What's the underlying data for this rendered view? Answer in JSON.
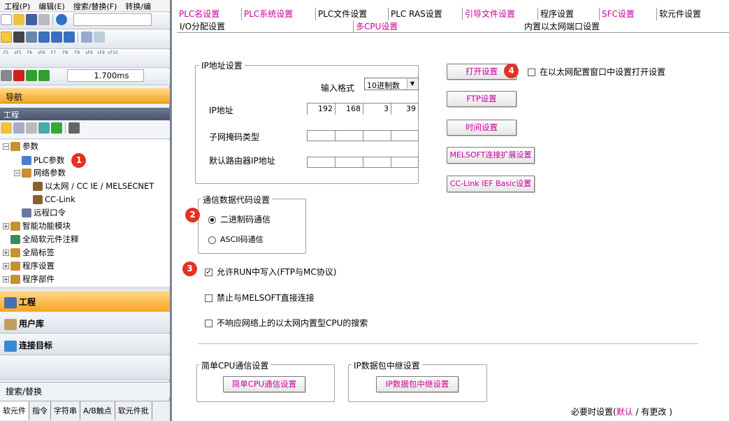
{
  "menu": [
    "工程(P)",
    "编辑(E)",
    "搜索/替换(F)",
    "转换/编"
  ],
  "toolbar": {
    "func_keys": [
      "F5",
      "sF5",
      "F6",
      "sF6",
      "F7",
      "F8",
      "F9",
      "sF9",
      "cF9",
      "cF10"
    ],
    "scan_time": "1.700ms"
  },
  "nav": {
    "header": "导航",
    "group_header": "工程",
    "tree": [
      {
        "label": "参数",
        "indent": 0,
        "expander": "−"
      },
      {
        "label": "PLC参数",
        "indent": 1,
        "badge": "1"
      },
      {
        "label": "网络参数",
        "indent": 1,
        "expander": "−"
      },
      {
        "label": "以太网 / CC IE / MELSECNET",
        "indent": 2
      },
      {
        "label": "CC-Link",
        "indent": 2
      },
      {
        "label": "远程口令",
        "indent": 1
      },
      {
        "label": "智能功能模块",
        "indent": 0,
        "expander": "+"
      },
      {
        "label": "全局软元件注释",
        "indent": 0
      },
      {
        "label": "全局标签",
        "indent": 0,
        "expander": "+"
      },
      {
        "label": "程序设置",
        "indent": 0,
        "expander": "+"
      },
      {
        "label": "程序部件",
        "indent": 0,
        "expander": "+"
      }
    ],
    "sections": [
      "工程",
      "用户库",
      "连接目标"
    ],
    "search_header": "搜索/替换",
    "bottom_tabs": [
      "软元件",
      "指令",
      "字符串",
      "A/B触点",
      "软元件批"
    ]
  },
  "dialog": {
    "tabs_row1": [
      {
        "label": "PLC名设置",
        "pink": true
      },
      {
        "label": "PLC系统设置",
        "pink": true
      },
      {
        "label": "PLC文件设置",
        "pink": false
      },
      {
        "label": "PLC RAS设置",
        "pink": false
      },
      {
        "label": "引导文件设置",
        "pink": true
      },
      {
        "label": "程序设置",
        "pink": false
      },
      {
        "label": "SFC设置",
        "pink": true
      },
      {
        "label": "软元件设置",
        "pink": false
      }
    ],
    "tabs_row2": [
      {
        "label": "I/O分配设置",
        "pink": false
      },
      {
        "label": "多CPU设置",
        "pink": true
      },
      {
        "label": "内置以太网端口设置",
        "pink": false
      }
    ],
    "ip_group": {
      "title": "IP地址设置",
      "input_format_label": "输入格式",
      "input_format_value": "10进制数",
      "ip_label": "IP地址",
      "ip_values": [
        "192",
        "168",
        "3",
        "39"
      ],
      "subnet_label": "子网掩码类型",
      "gateway_label": "默认路由器IP地址"
    },
    "code_group": {
      "title": "通信数据代码设置",
      "binary": "二进制码通信",
      "ascii": "ASCII码通信",
      "badge": "2"
    },
    "allow_run_write": {
      "label": "允许RUN中写入(FTP与MC协议)",
      "checked": true,
      "badge": "3"
    },
    "forbid_direct": {
      "label": "禁止与MELSOFT直接连接",
      "checked": false
    },
    "no_response": {
      "label": "不响应网络上的以太网内置型CPU的搜索",
      "checked": false
    },
    "buttons": {
      "open_setting": "打开设置",
      "ftp": "FTP设置",
      "time": "时间设置",
      "melsoft_ext": "MELSOFT连接扩展设置",
      "cclink": "CC-Link IEF Basic设置"
    },
    "open_badge": "4",
    "open_in_window": {
      "label": "在以太网配置窗口中设置打开设置",
      "checked": false
    },
    "simple_cpu": {
      "title": "简单CPU通信设置",
      "button": "简单CPU通信设置"
    },
    "ip_relay": {
      "title": "IP数据包中继设置",
      "button": "IP数据包中继设置"
    },
    "footer": {
      "prefix": "必要时设置(",
      "default": "默认",
      "sep": " / ",
      "changed": "有更改",
      "suffix": " )"
    }
  }
}
